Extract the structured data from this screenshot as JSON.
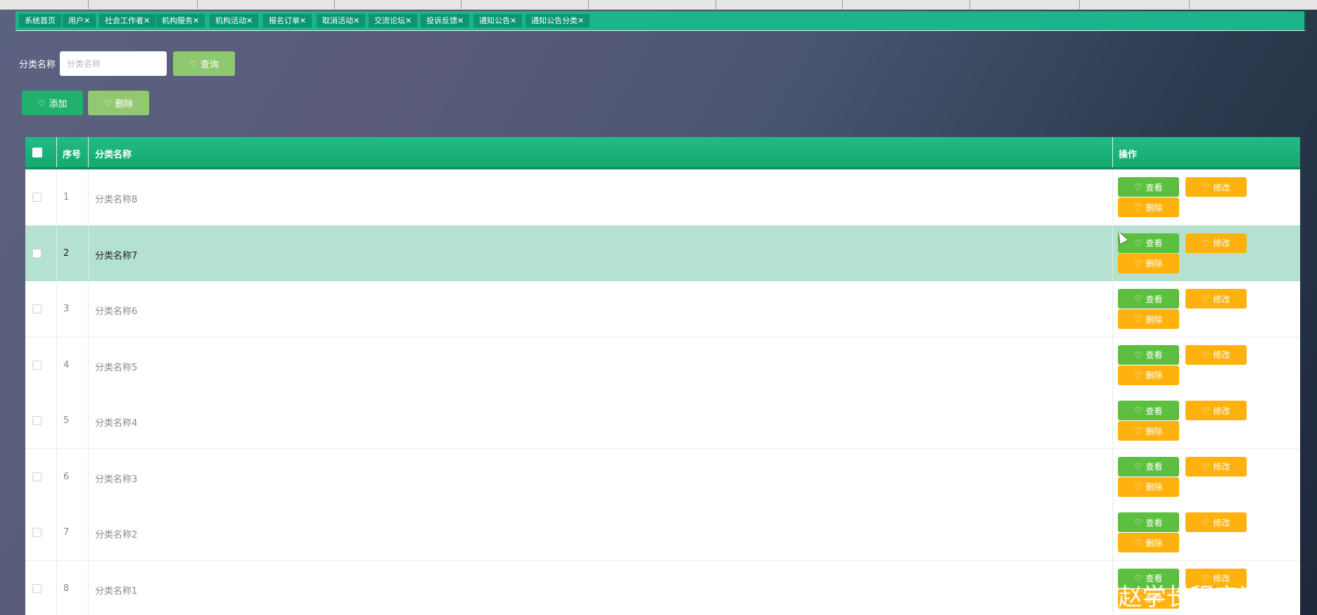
{
  "tabs": [
    {
      "label": "系统首页"
    },
    {
      "label": "用户✕"
    },
    {
      "label": "社会工作者✕"
    },
    {
      "label": "机构服务✕"
    },
    {
      "label": "机构活动✕"
    },
    {
      "label": "报名订单✕"
    },
    {
      "label": "取消活动✕"
    },
    {
      "label": "交流论坛✕"
    },
    {
      "label": "投诉反馈✕"
    },
    {
      "label": "通知公告✕"
    },
    {
      "label": "通知公告分类✕"
    }
  ],
  "search": {
    "label": "分类名称",
    "placeholder": "分类名称",
    "query_label": "查询"
  },
  "toolbar": {
    "add_label": "添加",
    "delete_label": "删除"
  },
  "table": {
    "headers": {
      "index": "序号",
      "name": "分类名称",
      "actions": "操作"
    },
    "action_labels": {
      "view": "查看",
      "edit": "修改",
      "delete": "删除"
    },
    "rows": [
      {
        "index": "1",
        "name": "分类名称8"
      },
      {
        "index": "2",
        "name": "分类名称7",
        "highlighted": true
      },
      {
        "index": "3",
        "name": "分类名称6"
      },
      {
        "index": "4",
        "name": "分类名称5"
      },
      {
        "index": "5",
        "name": "分类名称4"
      },
      {
        "index": "6",
        "name": "分类名称3"
      },
      {
        "index": "7",
        "name": "分类名称2"
      },
      {
        "index": "8",
        "name": "分类名称1"
      }
    ]
  },
  "watermark": "CSDN @ 赵学长程序设计",
  "icons": {
    "button_icon": "heart-icon"
  },
  "colors": {
    "accent": "#1fb38b",
    "view": "#5dbf3f",
    "edit_delete": "#ffb20f",
    "row_highlight": "#b5e1d1"
  }
}
